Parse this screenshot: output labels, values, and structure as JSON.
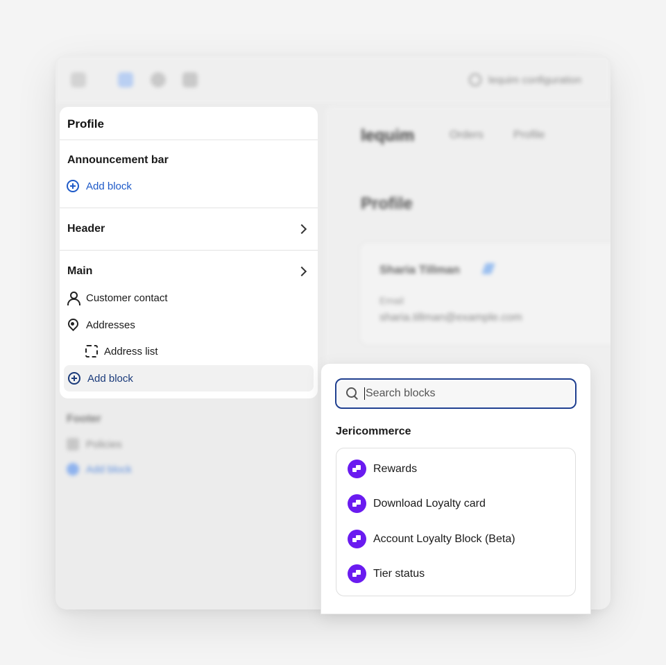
{
  "topbar": {
    "search_text": "lequim configuration"
  },
  "preview": {
    "shop_name": "lequim",
    "nav": [
      "Orders",
      "Profile"
    ],
    "page_heading": "Profile",
    "customer_name": "Sharia Tillman",
    "email_label": "Email",
    "email_value": "sharia.tillman@example.com"
  },
  "sidebar": {
    "title": "Profile",
    "announcement": {
      "title": "Announcement bar",
      "add_block": "Add block"
    },
    "header": {
      "title": "Header"
    },
    "main": {
      "title": "Main",
      "items": [
        "Customer contact",
        "Addresses",
        "Address list"
      ],
      "add_block": "Add block"
    },
    "footer": {
      "title": "Footer",
      "items": [
        "Policies"
      ],
      "add_block": "Add block"
    }
  },
  "popover": {
    "search_placeholder": "Search blocks",
    "group_title": "Jericommerce",
    "blocks": [
      "Rewards",
      "Download Loyalty card",
      "Account Loyalty Block (Beta)",
      "Tier status"
    ]
  },
  "colors": {
    "accent_blue": "#1e5ac8",
    "focus_ring": "#1f3f8f",
    "app_icon": "#6a1bf0"
  }
}
